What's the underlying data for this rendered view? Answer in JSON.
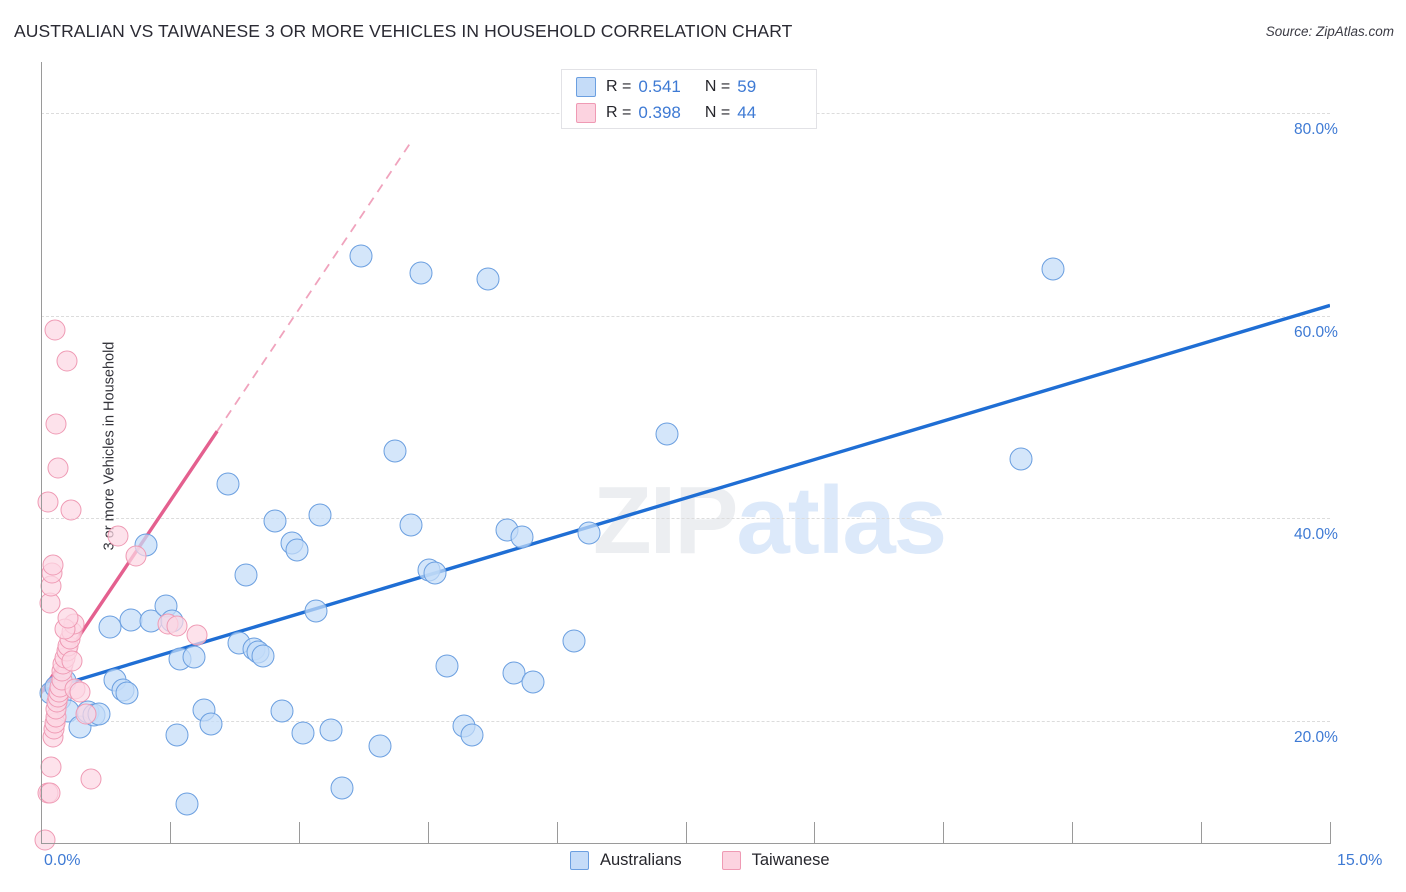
{
  "header": {
    "title": "AUSTRALIAN VS TAIWANESE 3 OR MORE VEHICLES IN HOUSEHOLD CORRELATION CHART",
    "source": "Source: ZipAtlas.com"
  },
  "watermark": {
    "part1": "ZIP",
    "part2": "atlas"
  },
  "stats_legend": {
    "rows": [
      {
        "series": "Australians",
        "color": "#c5dcf8",
        "r_label": "R =",
        "r_value": "0.541",
        "n_label": "N =",
        "n_value": "59"
      },
      {
        "series": "Taiwanese",
        "color": "#fcd3e0",
        "r_label": "R =",
        "r_value": "0.398",
        "n_label": "N =",
        "n_value": "44"
      }
    ]
  },
  "bottom_legend": {
    "items": [
      {
        "label": "Australians",
        "color": "#c5dcf8"
      },
      {
        "label": "Taiwanese",
        "color": "#fcd3e0"
      }
    ]
  },
  "chart_data": {
    "type": "scatter",
    "title": "AUSTRALIAN VS TAIWANESE 3 OR MORE VEHICLES IN HOUSEHOLD CORRELATION CHART",
    "xlabel": "",
    "ylabel": "3 or more Vehicles in Household",
    "xlim": [
      0.0,
      15.0
    ],
    "ylim": [
      8.0,
      85.0
    ],
    "x_tick_labels": [
      "0.0%",
      "15.0%"
    ],
    "y_tick_labels": [
      "20.0%",
      "40.0%",
      "60.0%",
      "80.0%"
    ],
    "y_tick_values": [
      20.0,
      40.0,
      60.0,
      80.0
    ],
    "grid": true,
    "legend_position": "bottom-center",
    "accent_blue": "#3e7ad4",
    "accent_pink": "#e4608f",
    "series": [
      {
        "name": "Australians",
        "color": "#c5dcf8",
        "edge_color": "#6b9fe0",
        "r": 0.541,
        "n": 59,
        "trendline": {
          "x0": 0.0,
          "y0": 23.0,
          "x1": 15.0,
          "y1": 61.0,
          "style": "solid",
          "color": "#1f6ed4"
        },
        "points": [
          [
            0.12,
            22.8
          ],
          [
            0.18,
            23.4
          ],
          [
            0.22,
            22.2
          ],
          [
            0.28,
            24.0
          ],
          [
            0.32,
            21.0
          ],
          [
            0.45,
            19.4
          ],
          [
            0.55,
            20.9
          ],
          [
            0.62,
            20.6
          ],
          [
            0.68,
            20.7
          ],
          [
            0.8,
            29.3
          ],
          [
            0.86,
            24.1
          ],
          [
            0.95,
            23.1
          ],
          [
            1.0,
            22.8
          ],
          [
            1.05,
            30.0
          ],
          [
            1.22,
            37.4
          ],
          [
            1.28,
            29.9
          ],
          [
            1.45,
            31.4
          ],
          [
            1.52,
            29.9
          ],
          [
            1.58,
            18.6
          ],
          [
            1.62,
            26.1
          ],
          [
            1.7,
            11.8
          ],
          [
            1.78,
            26.3
          ],
          [
            1.9,
            21.1
          ],
          [
            1.98,
            19.7
          ],
          [
            2.18,
            43.4
          ],
          [
            2.3,
            27.7
          ],
          [
            2.38,
            34.4
          ],
          [
            2.48,
            27.1
          ],
          [
            2.52,
            26.8
          ],
          [
            2.58,
            26.4
          ],
          [
            2.72,
            39.7
          ],
          [
            2.8,
            21.0
          ],
          [
            2.92,
            37.6
          ],
          [
            2.98,
            36.9
          ],
          [
            3.05,
            18.8
          ],
          [
            3.2,
            30.9
          ],
          [
            3.25,
            40.3
          ],
          [
            3.38,
            19.1
          ],
          [
            3.5,
            13.4
          ],
          [
            3.72,
            65.9
          ],
          [
            3.95,
            17.6
          ],
          [
            4.12,
            46.6
          ],
          [
            4.3,
            39.4
          ],
          [
            4.42,
            64.2
          ],
          [
            4.52,
            34.9
          ],
          [
            4.58,
            34.6
          ],
          [
            4.72,
            25.5
          ],
          [
            4.92,
            19.5
          ],
          [
            5.02,
            18.6
          ],
          [
            5.2,
            63.6
          ],
          [
            5.42,
            38.9
          ],
          [
            5.5,
            24.8
          ],
          [
            5.6,
            38.2
          ],
          [
            5.72,
            23.9
          ],
          [
            6.2,
            27.9
          ],
          [
            6.38,
            38.6
          ],
          [
            7.28,
            48.3
          ],
          [
            11.4,
            45.9
          ],
          [
            11.78,
            64.6
          ]
        ]
      },
      {
        "name": "Taiwanese",
        "color": "#fcd3e0",
        "edge_color": "#ef9ab4",
        "r": 0.398,
        "n": 44,
        "trendline": {
          "x0": 0.0,
          "y0": 22.8,
          "x1": 2.05,
          "y1": 48.6,
          "style": "solid",
          "color": "#e4608f"
        },
        "trendline_extension": {
          "x0": 2.05,
          "y0": 48.6,
          "x1": 4.32,
          "y1": 77.3,
          "style": "dashed",
          "color": "#f0a3bd"
        },
        "points": [
          [
            0.05,
            8.3
          ],
          [
            0.08,
            12.9
          ],
          [
            0.1,
            12.9
          ],
          [
            0.12,
            15.5
          ],
          [
            0.14,
            18.5
          ],
          [
            0.15,
            19.2
          ],
          [
            0.16,
            19.8
          ],
          [
            0.17,
            20.4
          ],
          [
            0.18,
            21.2
          ],
          [
            0.19,
            21.9
          ],
          [
            0.2,
            22.4
          ],
          [
            0.21,
            22.9
          ],
          [
            0.22,
            23.4
          ],
          [
            0.24,
            24.1
          ],
          [
            0.25,
            25.0
          ],
          [
            0.26,
            25.6
          ],
          [
            0.28,
            26.2
          ],
          [
            0.3,
            26.9
          ],
          [
            0.32,
            27.4
          ],
          [
            0.34,
            28.1
          ],
          [
            0.36,
            28.8
          ],
          [
            0.38,
            29.6
          ],
          [
            0.1,
            31.7
          ],
          [
            0.12,
            33.3
          ],
          [
            0.13,
            34.6
          ],
          [
            0.14,
            35.4
          ],
          [
            0.28,
            29.1
          ],
          [
            0.32,
            30.2
          ],
          [
            0.36,
            25.9
          ],
          [
            0.4,
            23.2
          ],
          [
            0.45,
            22.9
          ],
          [
            0.52,
            20.7
          ],
          [
            0.58,
            14.3
          ],
          [
            0.08,
            41.6
          ],
          [
            0.35,
            40.8
          ],
          [
            0.2,
            45.0
          ],
          [
            0.18,
            49.3
          ],
          [
            0.3,
            55.5
          ],
          [
            0.16,
            58.6
          ],
          [
            0.9,
            38.3
          ],
          [
            1.1,
            36.3
          ],
          [
            1.48,
            29.6
          ],
          [
            1.58,
            29.4
          ],
          [
            1.82,
            28.5
          ]
        ]
      }
    ]
  }
}
